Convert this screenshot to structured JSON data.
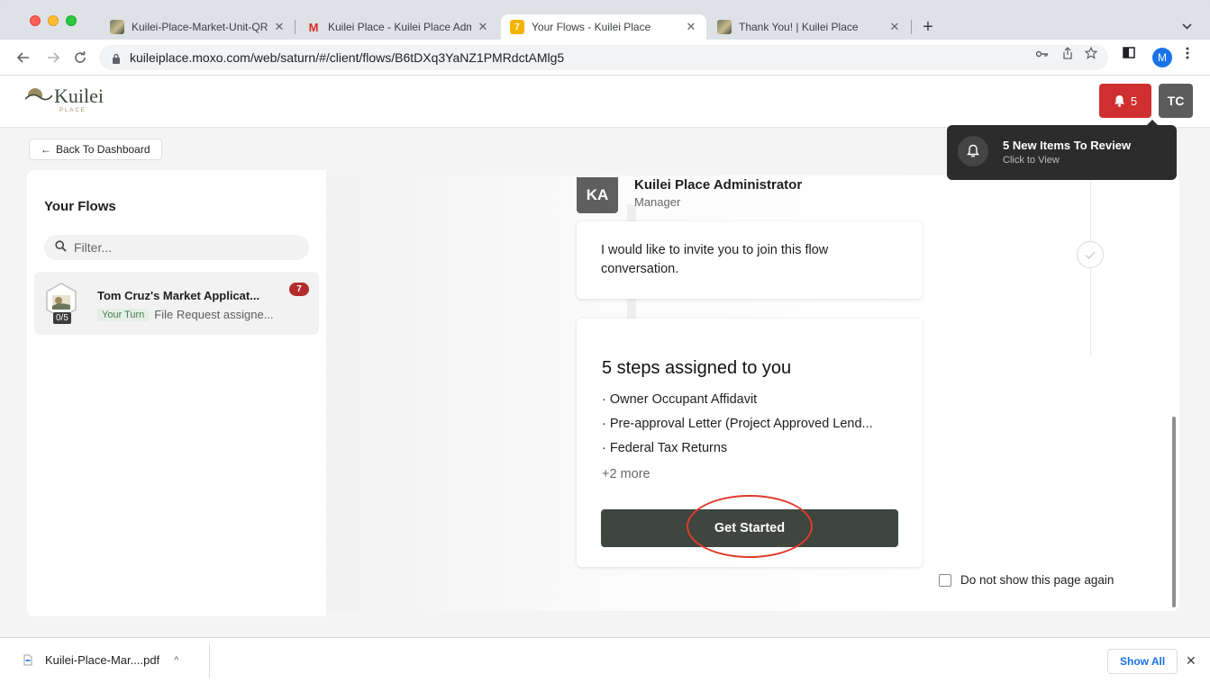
{
  "browser": {
    "tabs": [
      {
        "title": "Kuilei-Place-Market-Unit-QRA",
        "icon": "photo-favicon"
      },
      {
        "title": "Kuilei Place - Kuilei Place Admi",
        "icon": "gmail-favicon"
      },
      {
        "title": "Your Flows - Kuilei Place",
        "icon": "moxo-favicon",
        "active": true
      },
      {
        "title": "Thank You! | Kuilei Place",
        "icon": "photo-favicon"
      }
    ],
    "gmail_glyph": "M",
    "moxo_glyph": "7",
    "new_tab_glyph": "+",
    "tab_close_glyph": "✕",
    "url": "kuileiplace.moxo.com/web/saturn/#/client/flows/B6tDXq3YaNZ1PMRdctAMlg5",
    "profile_initial": "M"
  },
  "header": {
    "logo_text": "Kuilei",
    "logo_sub": "PLACE",
    "notification_count": "5",
    "user_initials": "TC"
  },
  "notification_popover": {
    "title": "5 New Items To Review",
    "subtitle": "Click to View"
  },
  "back_button": {
    "label": "Back To Dashboard",
    "arrow": "←"
  },
  "sidebar": {
    "title": "Your Flows",
    "filter_placeholder": "Filter...",
    "flows": [
      {
        "title": "Tom Cruz's Market Applicat...",
        "badge": "7",
        "progress": "0/5",
        "turn_label": "Your Turn",
        "subtitle": "File Request assigne..."
      }
    ]
  },
  "main": {
    "sender": {
      "initials": "KA",
      "name": "Kuilei Place Administrator",
      "role": "Manager"
    },
    "message": "I would like to invite you to join this flow conversation.",
    "steps_card": {
      "title": "5 steps assigned to you",
      "steps": [
        "· Owner Occupant Affidavit",
        "· Pre-approval Letter (Project Approved Lend...",
        "· Federal Tax Returns"
      ],
      "more": "+2 more",
      "button_label": "Get Started"
    },
    "dont_show_label": "Do not show this page again",
    "dont_show_checked": false
  },
  "downloads": {
    "file_name": "Kuilei-Place-Mar....pdf",
    "caret": "^",
    "show_all_label": "Show All",
    "close_glyph": "✕"
  },
  "colors": {
    "brand_dark": "#3e463f",
    "alert_red": "#cf2f2f",
    "badge_red": "#b32c2c",
    "annotation_red": "#e03b2c",
    "turn_green": "#4a7d56"
  }
}
